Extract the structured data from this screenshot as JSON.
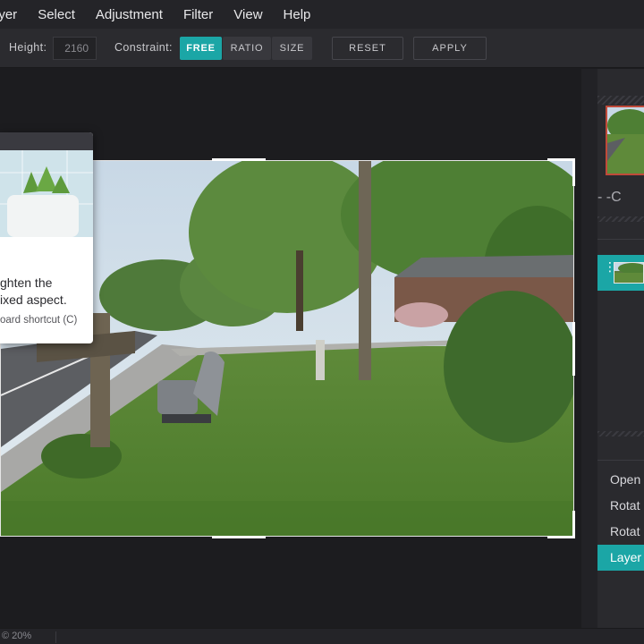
{
  "menu": {
    "items": [
      "ayer",
      "Select",
      "Adjustment",
      "Filter",
      "View",
      "Help"
    ]
  },
  "toolbar": {
    "height_label": "Height:",
    "height_value": "2160",
    "constraint_label": "Constraint:",
    "constraint_options": [
      "FREE",
      "RATIO",
      "SIZE"
    ],
    "constraint_selected": "FREE",
    "reset_label": "RESET",
    "apply_label": "APPLY"
  },
  "tooltip": {
    "line1": "ghten the",
    "line2": "ixed aspect.",
    "line3": "oard shortcut (C)"
  },
  "right_panel": {
    "zoom_row": "- -C",
    "history": [
      "Open",
      "Rotat",
      "Rotat",
      "Layer"
    ],
    "history_active_index": 3
  },
  "status": {
    "zoom": "© 20%"
  },
  "colors": {
    "accent": "#1ba6a6",
    "menubar_bg": "#242428",
    "toolbar_bg": "#2b2b2f",
    "canvas_bg": "#1c1c1f",
    "panel_bg": "#2a2a2e"
  }
}
